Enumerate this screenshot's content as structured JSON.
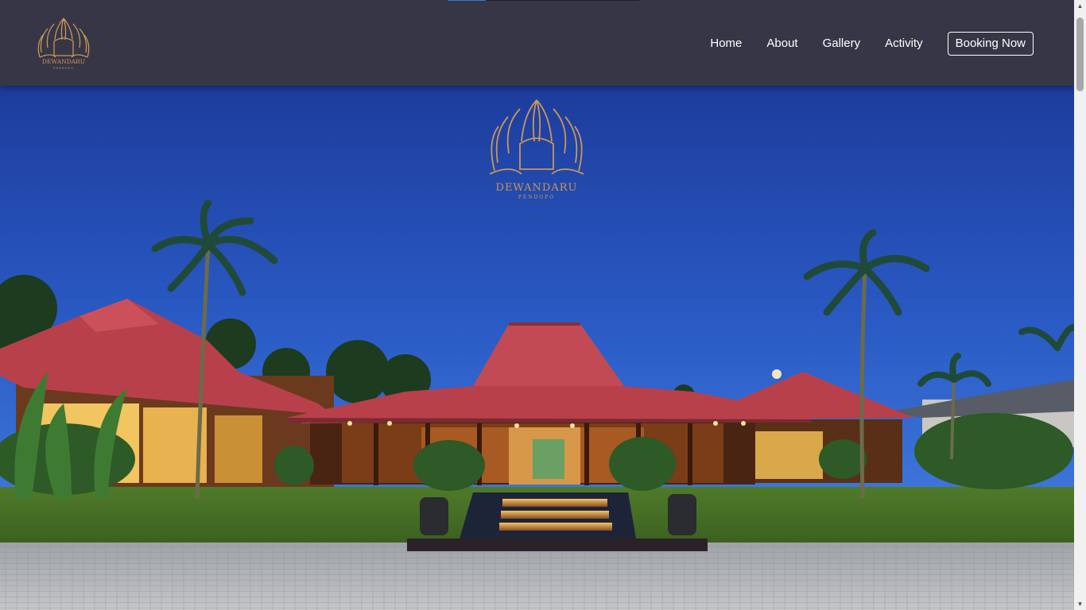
{
  "header": {
    "logo_name": "DEWANDARU",
    "logo_sub": "PENDOPO",
    "scroll_progress": 0.2
  },
  "nav": {
    "items": [
      {
        "label": "Home"
      },
      {
        "label": "About"
      },
      {
        "label": "Gallery"
      },
      {
        "label": "Activity"
      }
    ],
    "booking_label": "Booking Now"
  },
  "hero": {
    "logo_name": "DEWANDARU",
    "logo_sub": "PENDOPO"
  },
  "colors": {
    "header_bg": "#363646",
    "logo_gold": "#c9975a",
    "roof_red": "#b8404a",
    "sky_top": "#1f3f9e",
    "nav_text": "#ffffff"
  }
}
